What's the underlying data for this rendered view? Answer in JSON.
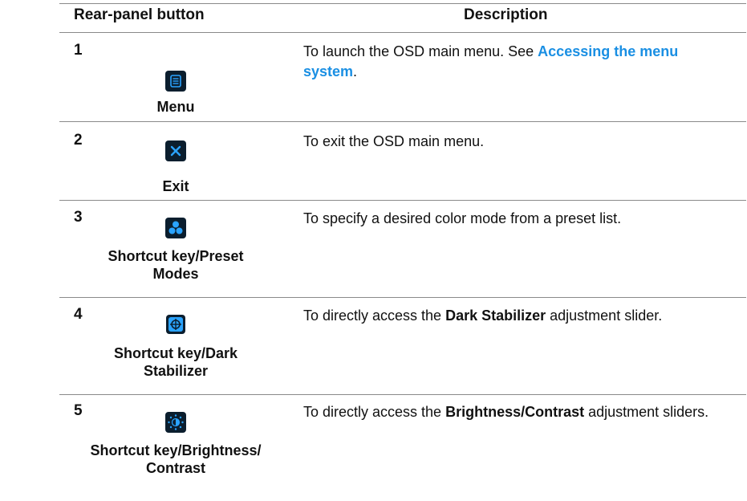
{
  "header": {
    "col_button": "Rear-panel button",
    "col_description": "Description"
  },
  "rows": [
    {
      "number": "1",
      "icon": "menu-icon",
      "label": "Menu",
      "desc_before": "To launch the OSD main menu. See ",
      "desc_link": "Accessing the menu system",
      "desc_after": "."
    },
    {
      "number": "2",
      "icon": "close-icon",
      "label": "Exit",
      "desc_text": "To exit the OSD main menu."
    },
    {
      "number": "3",
      "icon": "preset-modes-icon",
      "label_line1": "Shortcut key/Preset",
      "label_line2": "Modes",
      "desc_text": "To specify a desired color mode from a preset list."
    },
    {
      "number": "4",
      "icon": "dark-stabilizer-icon",
      "label_line1": "Shortcut key/Dark",
      "label_line2": "Stabilizer",
      "desc_before": "To directly access the ",
      "desc_bold": "Dark Stabilizer",
      "desc_after": " adjustment slider."
    },
    {
      "number": "5",
      "icon": "brightness-contrast-icon",
      "label_line1": "Shortcut key/Brightness/",
      "label_line2": "Contrast",
      "desc_before": "To directly access the ",
      "desc_bold": "Brightness/Contrast",
      "desc_after": " adjustment sliders."
    }
  ],
  "colors": {
    "link": "#1a8fe3",
    "icon_background": "#0b1e2e",
    "icon_accent": "#2aa3ff",
    "rule": "#8a8a8a"
  }
}
